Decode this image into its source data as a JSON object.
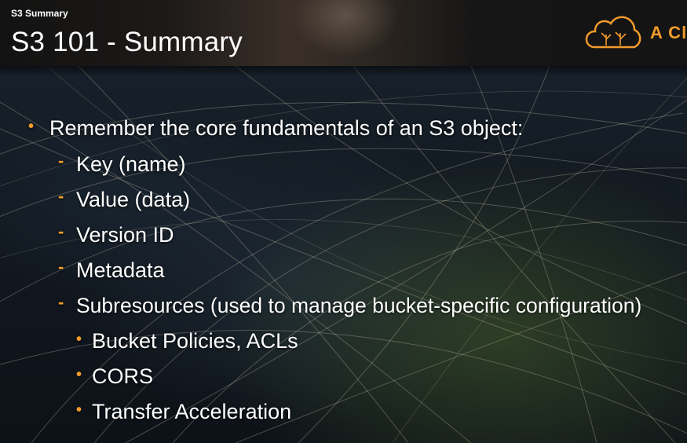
{
  "header": {
    "kicker": "S3 Summary",
    "title": "S3 101 - Summary",
    "logo_text": "A Cl",
    "logo_icon": "cloud-tree-logo-icon",
    "accent_color": "#f29b2b"
  },
  "bullets": {
    "main": "Remember the core fundamentals of an S3 object:",
    "items": [
      "Key (name)",
      "Value (data)",
      "Version ID",
      "Metadata",
      "Subresources (used to manage bucket-specific configuration)"
    ],
    "subitems": [
      "Bucket Policies, ACLs",
      "CORS",
      "Transfer Acceleration"
    ],
    "marks": {
      "level1": "•",
      "level2": "-",
      "level3": "•"
    }
  }
}
